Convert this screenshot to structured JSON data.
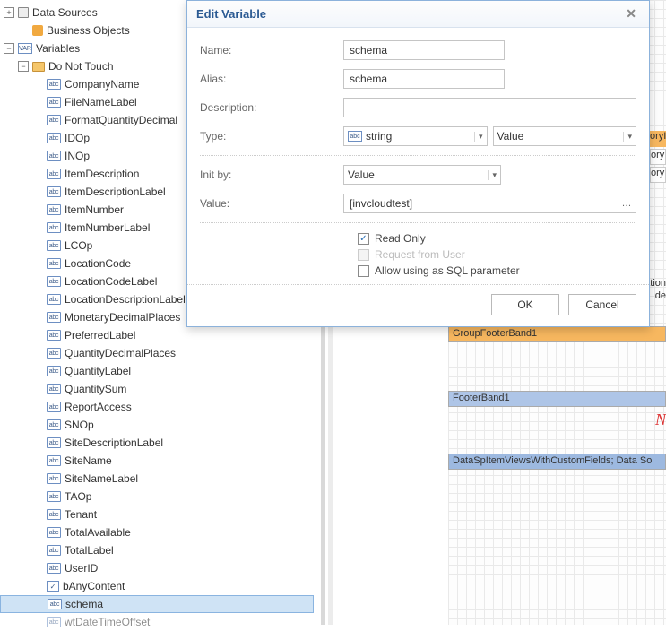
{
  "tree": {
    "dataSources": "Data Sources",
    "businessObjects": "Business Objects",
    "variables": "Variables",
    "folder": "Do Not Touch",
    "items": [
      "CompanyName",
      "FileNameLabel",
      "FormatQuantityDecimal",
      "IDOp",
      "INOp",
      "ItemDescription",
      "ItemDescriptionLabel",
      "ItemNumber",
      "ItemNumberLabel",
      "LCOp",
      "LocationCode",
      "LocationCodeLabel",
      "LocationDescriptionLabel",
      "MonetaryDecimalPlaces",
      "PreferredLabel",
      "QuantityDecimalPlaces",
      "QuantityLabel",
      "QuantitySum",
      "ReportAccess",
      "SNOp",
      "SiteDescriptionLabel",
      "SiteName",
      "SiteNameLabel",
      "TAOp",
      "Tenant",
      "TotalAvailable",
      "TotalLabel",
      "UserID"
    ],
    "boolItem": "bAnyContent",
    "selected": "schema",
    "lastCut": "wtDateTimeOffset"
  },
  "surface": {
    "groupFooter": "GroupFooterBand1",
    "footer": "FooterBand1",
    "dataBand": "DataSpItemViewsWithCustomFields; Data So",
    "frag1": "oryI",
    "frag2": "ory",
    "frag3": "ory",
    "fragAtion": "'ation",
    "fragDe": "de",
    "redN": "N"
  },
  "dialog": {
    "title": "Edit Variable",
    "labels": {
      "name": "Name:",
      "alias": "Alias:",
      "description": "Description:",
      "type": "Type:",
      "initBy": "Init by:",
      "value": "Value:"
    },
    "values": {
      "name": "schema",
      "alias": "schema",
      "description": "",
      "typeText": "string",
      "typeKind": "Value",
      "initBy": "Value",
      "value": "[invcloudtest]"
    },
    "checks": {
      "readOnly": {
        "label": "Read Only",
        "checked": true
      },
      "requestUser": {
        "label": "Request from User",
        "checked": false,
        "disabled": true
      },
      "allowSql": {
        "label": "Allow using as SQL parameter",
        "checked": false
      }
    },
    "buttons": {
      "ok": "OK",
      "cancel": "Cancel"
    },
    "iconAbc": "abc"
  }
}
